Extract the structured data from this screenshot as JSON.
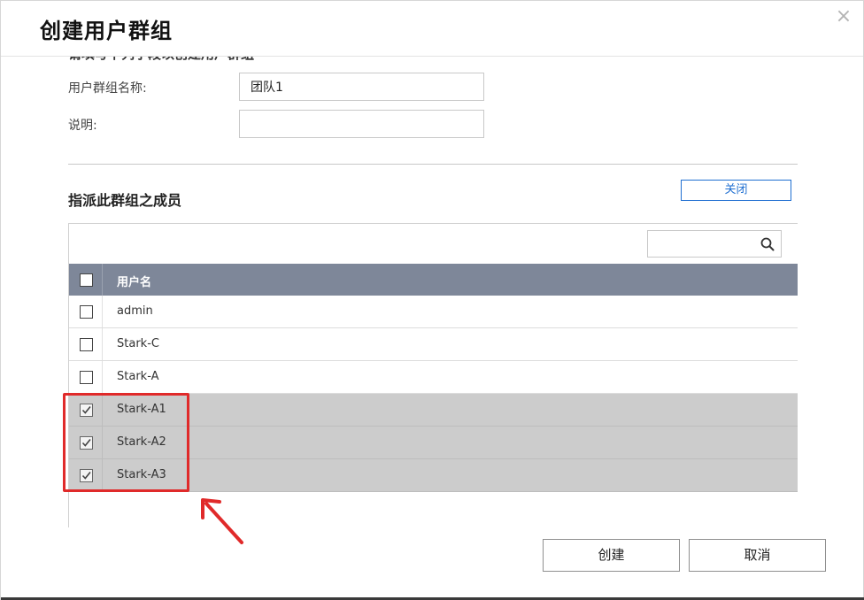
{
  "dialog": {
    "title": "创建用户群组",
    "close_icon": "×",
    "clipped_heading": "请填写下列字段以创建用户群组"
  },
  "form": {
    "name_label": "用户群组名称:",
    "name_value": "团队1",
    "desc_label": "说明:",
    "desc_value": ""
  },
  "members": {
    "section_title": "指派此群组之成员",
    "close_button": "关闭",
    "search_placeholder": "",
    "column_header": "用户名",
    "rows": [
      {
        "name": "admin",
        "checked": false
      },
      {
        "name": "Stark-C",
        "checked": false
      },
      {
        "name": "Stark-A",
        "checked": false
      },
      {
        "name": "Stark-A1",
        "checked": true
      },
      {
        "name": "Stark-A2",
        "checked": true
      },
      {
        "name": "Stark-A3",
        "checked": true
      }
    ]
  },
  "footer": {
    "create_button": "创建",
    "cancel_button": "取消"
  },
  "colors": {
    "table_header": "#7e8799",
    "selected_row": "#cccccc",
    "annotation_red": "#e02a2a",
    "link_blue": "#1f6fd1"
  },
  "icons": {
    "search": "search-icon",
    "close": "close-icon",
    "checkbox_checked": "checkbox-checked-icon",
    "checkbox_unchecked": "checkbox-unchecked-icon",
    "annotation_arrow": "arrow-icon"
  }
}
